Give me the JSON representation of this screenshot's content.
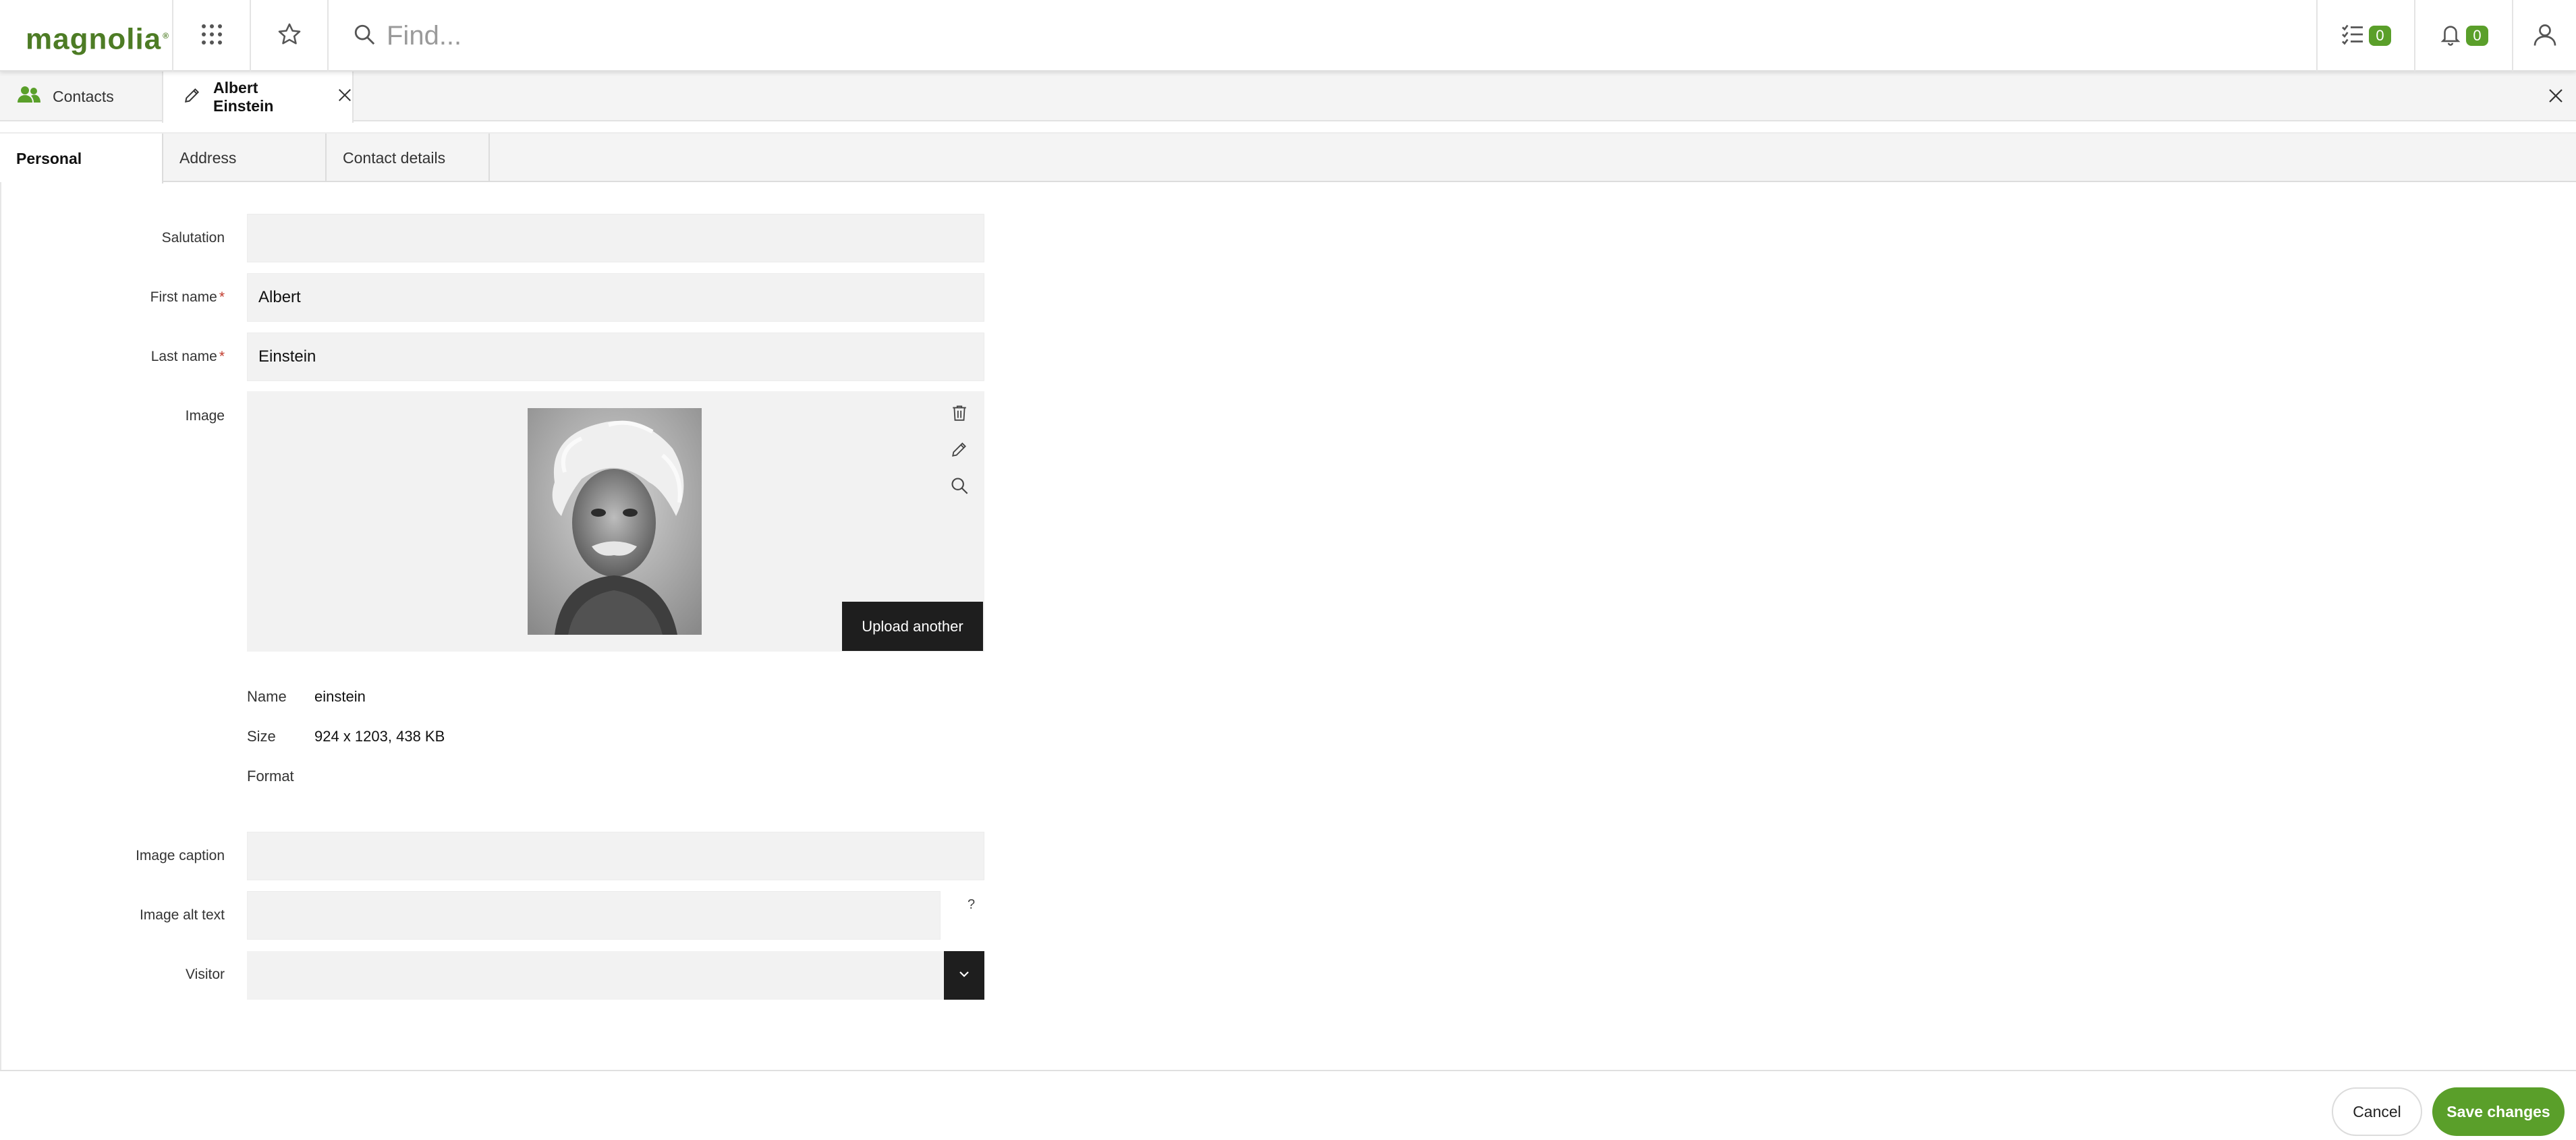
{
  "header": {
    "logo_text": "magnolia",
    "search_placeholder": "Find...",
    "tasks_count": "0",
    "notifications_count": "0"
  },
  "app_tabs": {
    "contacts_label": "Contacts",
    "edit_label": "Albert Einstein"
  },
  "form_tabs": [
    "Personal",
    "Address",
    "Contact details"
  ],
  "form": {
    "salutation": {
      "label": "Salutation",
      "value": ""
    },
    "first_name": {
      "label": "First name",
      "required": "*",
      "value": "Albert"
    },
    "last_name": {
      "label": "Last name",
      "required": "*",
      "value": "Einstein"
    },
    "image": {
      "label": "Image",
      "upload_label": "Upload another",
      "name_key": "Name",
      "name_value": "einstein",
      "size_key": "Size",
      "size_value": "924 x 1203, 438 KB",
      "format_key": "Format",
      "format_value": ""
    },
    "image_caption": {
      "label": "Image caption",
      "value": ""
    },
    "image_alt": {
      "label": "Image alt text",
      "value": "",
      "help": "?"
    },
    "visitor": {
      "label": "Visitor",
      "value": ""
    }
  },
  "footer": {
    "cancel_label": "Cancel",
    "save_label": "Save changes"
  },
  "colors": {
    "brand_green": "#5a9f2a",
    "logo_green": "#4d7c25",
    "dark_button": "#1e1e1e",
    "field_bg": "#f2f2f2"
  },
  "icons": [
    "apps-grid-icon",
    "star-icon",
    "search-icon",
    "tasks-icon",
    "bell-icon",
    "user-icon",
    "contacts-icon",
    "pencil-icon",
    "close-icon",
    "trash-icon",
    "edit-icon",
    "zoom-icon",
    "chevron-down-icon"
  ]
}
